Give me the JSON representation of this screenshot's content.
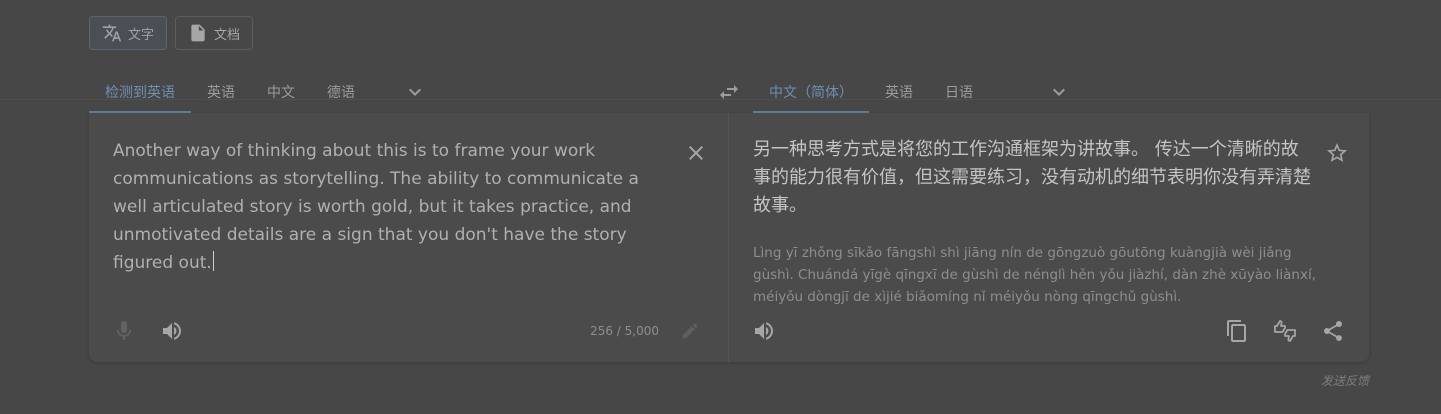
{
  "modes": [
    {
      "label": "文字",
      "icon": "translate-icon",
      "active": true
    },
    {
      "label": "文档",
      "icon": "document-icon",
      "active": false
    }
  ],
  "source": {
    "tabs": [
      "检测到英语",
      "英语",
      "中文",
      "德语"
    ],
    "text": "Another way of thinking about this is to frame your work communications as storytelling. The ability to communicate a well articulated story is worth gold, but it takes practice, and unmotivated details are a sign that you don't have the story figured out.",
    "char_count": "256 / 5,000"
  },
  "target": {
    "tabs": [
      "中文（简体）",
      "英语",
      "日语"
    ],
    "text": "另一种思考方式是将您的工作沟通框架为讲故事。 传达一个清晰的故事的能力很有价值，但这需要练习，没有动机的细节表明你没有弄清楚故事。",
    "transliteration": "Lìng yī zhǒng sīkǎo fāngshì shì jiāng nín de gōngzuò gōutōng kuàngjià wèi jiǎng gùshì. Chuándá yīgè qīngxī de gùshì de nénglì hěn yǒu jiàzhí, dàn zhè xūyào liànxí, méiyǒu dòngjī de xìjié biǎomíng nǐ méiyǒu nòng qīngchǔ gùshì."
  },
  "feedback_label": "发送反馈",
  "colors": {
    "background": "#474747",
    "accent": "#6f8fb0",
    "text": "#b0b0b0"
  }
}
